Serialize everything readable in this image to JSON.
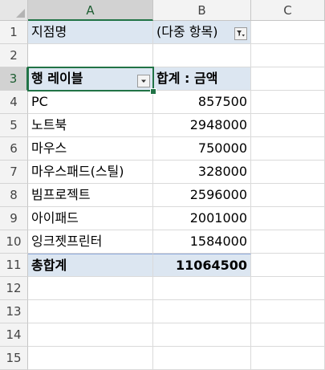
{
  "columns": [
    "A",
    "B",
    "C"
  ],
  "rows": [
    "1",
    "2",
    "3",
    "4",
    "5",
    "6",
    "7",
    "8",
    "9",
    "10",
    "11",
    "12",
    "13",
    "14",
    "15"
  ],
  "cells": {
    "a1": "지점명",
    "b1": "(다중 항목)",
    "a3": "행 레이블",
    "b3": "합계 : 금액",
    "data": [
      {
        "label": "PC",
        "value": "857500"
      },
      {
        "label": "노트북",
        "value": "2948000"
      },
      {
        "label": "마우스",
        "value": "750000"
      },
      {
        "label": "마우스패드(스틸)",
        "value": "328000"
      },
      {
        "label": "빔프로젝트",
        "value": "2596000"
      },
      {
        "label": "아이패드",
        "value": "2001000"
      },
      {
        "label": "잉크젯프린터",
        "value": "1584000"
      }
    ],
    "a11": "총합계",
    "b11": "11064500"
  },
  "icons": {
    "filter_applied": "filter-funnel-dropdown-icon",
    "row_labels_dropdown": "dropdown-arrow-icon",
    "select_all": "select-all-triangle-icon"
  },
  "colors": {
    "pivot_band": "#dce6f1",
    "selection": "#217346"
  }
}
